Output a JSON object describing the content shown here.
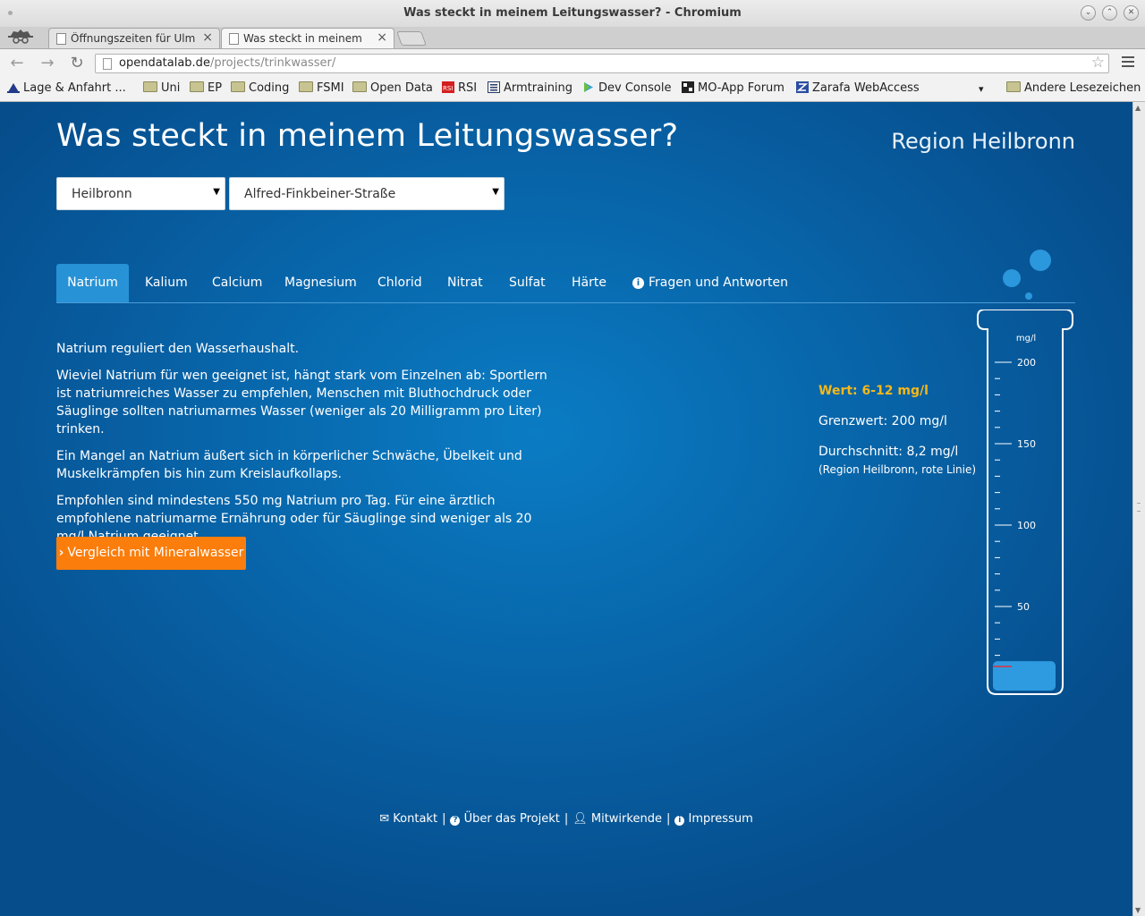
{
  "window": {
    "title": "Was steckt in meinem Leitungswasser? - Chromium"
  },
  "browser_tabs": [
    {
      "label": "Öffnungszeiten für Ulm",
      "close": "×"
    },
    {
      "label": "Was steckt in meinem",
      "close": "×"
    }
  ],
  "address_bar": {
    "host": "opendatalab.de",
    "path": "/projects/trinkwasser/"
  },
  "bookmarks": [
    {
      "label": "Lage & Anfahrt ...",
      "icon": "map-pin-icon"
    },
    {
      "label": "Uni",
      "icon": "folder-icon"
    },
    {
      "label": "EP",
      "icon": "folder-icon"
    },
    {
      "label": "Coding",
      "icon": "folder-icon"
    },
    {
      "label": "FSMI",
      "icon": "folder-icon"
    },
    {
      "label": "Open Data",
      "icon": "folder-icon"
    },
    {
      "label": "RSI",
      "icon": "rsi-icon"
    },
    {
      "label": "Armtraining",
      "icon": "list-icon"
    },
    {
      "label": "Dev Console",
      "icon": "play-store-icon"
    },
    {
      "label": "MO-App Forum",
      "icon": "forum-icon"
    },
    {
      "label": "Zarafa WebAccess",
      "icon": "zarafa-icon"
    }
  ],
  "bookmarks_overflow": "▾",
  "bookmarks_other": "Andere Lesezeichen",
  "page": {
    "title": "Was steckt in meinem Leitungswasser?",
    "region": "Region Heilbronn",
    "city_select": "Heilbronn",
    "street_select": "Alfred-Finkbeiner-Straße"
  },
  "tabs": [
    {
      "label": "Natrium",
      "active": true
    },
    {
      "label": "Kalium"
    },
    {
      "label": "Calcium"
    },
    {
      "label": "Magnesium"
    },
    {
      "label": "Chlorid"
    },
    {
      "label": "Nitrat"
    },
    {
      "label": "Sulfat"
    },
    {
      "label": "Härte"
    },
    {
      "label": "Fragen und Antworten",
      "icon": "info-icon"
    }
  ],
  "content": {
    "p1": "Natrium reguliert den Wasserhaushalt.",
    "p2": "Wieviel Natrium für wen geeignet ist, hängt stark vom Einzelnen ab: Sportlern ist natriumreiches Wasser zu empfehlen, Menschen mit Bluthochdruck oder Säuglinge sollten natriumarmes Wasser (weniger als 20 Milligramm pro Liter) trinken.",
    "p3": "Ein Mangel an Natrium äußert sich in körperlicher Schwäche, Übelkeit und Muskelkrämpfen bis hin zum Kreislaufkollaps.",
    "p4": "Empfohlen sind mindestens 550 mg Natrium pro Tag. Für eine ärztlich empfohlene natriumarme Ernährung oder für Säuglinge sind weniger als 20 mg/l Natrium geeignet.",
    "compare_button": "Vergleich mit Mineralwasser"
  },
  "stats": {
    "wert": "Wert: 6-12 mg/l",
    "grenzwert": "Grenzwert: 200 mg/l",
    "durchschnitt": "Durchschnitt: 8,2 mg/l",
    "note": "(Region Heilbronn, rote Linie)"
  },
  "gauge": {
    "unit": "mg/l",
    "scale_max": 200,
    "labels": [
      "200",
      "150",
      "100",
      "50"
    ],
    "label_values": [
      200,
      150,
      100,
      50
    ],
    "fill_range": [
      6,
      12
    ],
    "average": 8.2,
    "fill_color": "#2e9be0",
    "average_color": "#e0323a"
  },
  "footer": [
    {
      "label": "Kontakt",
      "icon": "envelope-icon"
    },
    {
      "label": "Über das Projekt",
      "icon": "question-icon"
    },
    {
      "label": "Mitwirkende",
      "icon": "user-icon"
    },
    {
      "label": "Impressum",
      "icon": "info-icon"
    }
  ],
  "colors": {
    "accent_orange": "#fb7d0b",
    "value_yellow": "#f5b81a",
    "active_tab": "#2892d6",
    "page_blue": "#0864a8"
  }
}
